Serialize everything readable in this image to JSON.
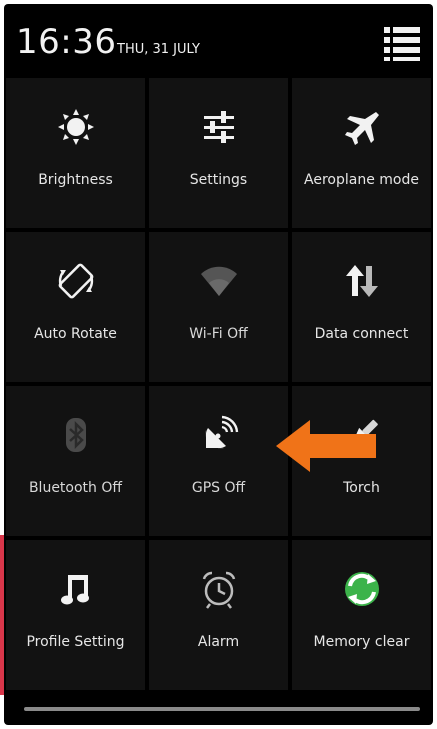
{
  "status_bar": {
    "time": "16:36",
    "date": "THU, 31 JULY",
    "menu_icon": "list-menu-icon"
  },
  "tiles": [
    {
      "label": "Brightness",
      "icon": "brightness-icon",
      "state": "on"
    },
    {
      "label": "Settings",
      "icon": "settings-sliders-icon",
      "state": "on"
    },
    {
      "label": "Aeroplane mode",
      "icon": "airplane-icon",
      "state": "on"
    },
    {
      "label": "Auto Rotate",
      "icon": "rotate-icon",
      "state": "on"
    },
    {
      "label": "Wi-Fi Off",
      "icon": "wifi-icon",
      "state": "off"
    },
    {
      "label": "Data connect",
      "icon": "data-arrows-icon",
      "state": "on"
    },
    {
      "label": "Bluetooth Off",
      "icon": "bluetooth-icon",
      "state": "off"
    },
    {
      "label": "GPS Off",
      "icon": "gps-satellite-icon",
      "state": "off"
    },
    {
      "label": "Torch",
      "icon": "torch-icon",
      "state": "on"
    },
    {
      "label": "Profile Setting",
      "icon": "music-note-icon",
      "state": "on"
    },
    {
      "label": "Alarm",
      "icon": "alarm-clock-icon",
      "state": "on"
    },
    {
      "label": "Memory clear",
      "icon": "memory-clear-icon",
      "state": "on"
    }
  ],
  "annotation": {
    "icon": "orange-arrow-icon",
    "color": "#f07318"
  },
  "colors": {
    "background": "#000000",
    "tile": "#121212",
    "text": "#e6e6e6",
    "accent_green": "#3cb34a"
  }
}
